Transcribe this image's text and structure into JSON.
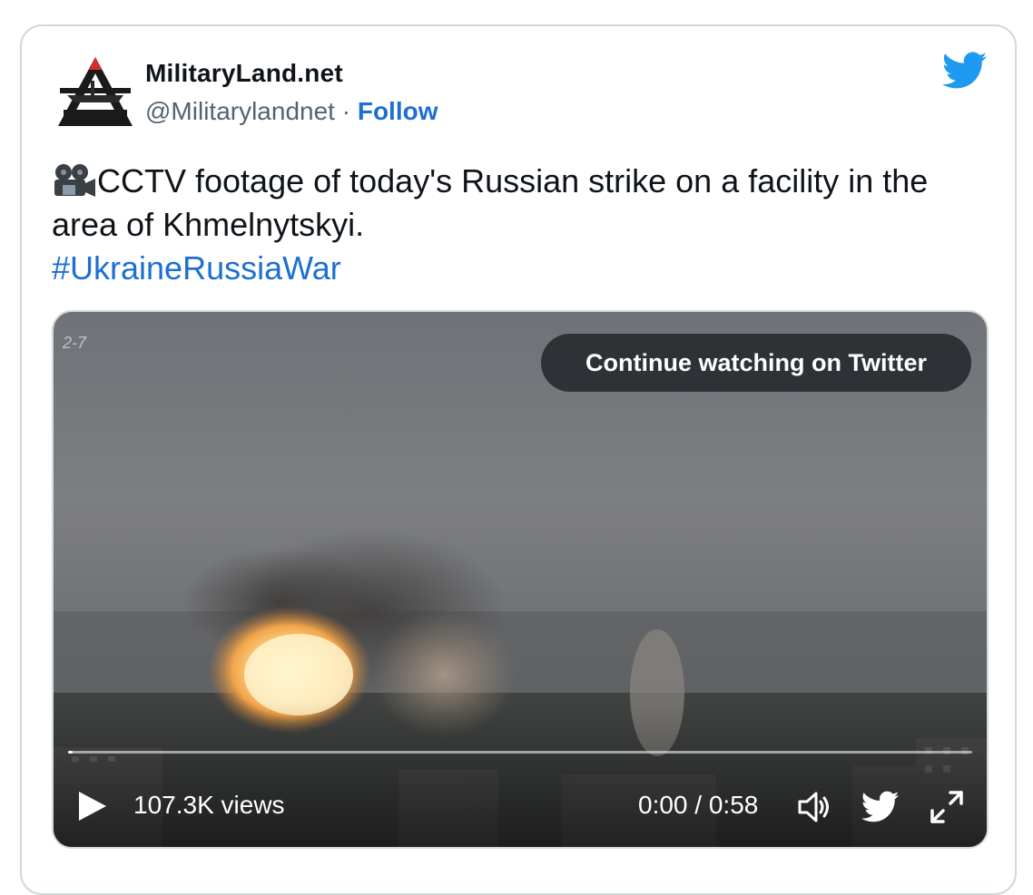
{
  "author": {
    "name": "MilitaryLand.net",
    "handle": "@Militarylandnet",
    "separator": " · ",
    "follow_label": "Follow",
    "avatar_icon": "militaryland-logo"
  },
  "brand": {
    "icon": "twitter-bird-icon",
    "color": "#1d9bf0"
  },
  "tweet": {
    "emoji_icon": "movie-camera-icon",
    "text": "CCTV footage of today's Russian strike on a facility in the area of Khmelnytskyi.",
    "hashtag": "#UkraineRussiaWar",
    "link_color": "#1d6fd1"
  },
  "media": {
    "camera_stamp": "2-7",
    "continue_label": "Continue watching on Twitter",
    "views": "107.3K views",
    "time_current": "0:00",
    "time_total": "0:58",
    "time_separator": " / ",
    "progress": 0.005,
    "controls": {
      "play_icon": "play-icon",
      "volume_icon": "volume-icon",
      "twitter_icon": "twitter-bird-icon",
      "fullscreen_icon": "fullscreen-icon"
    }
  }
}
